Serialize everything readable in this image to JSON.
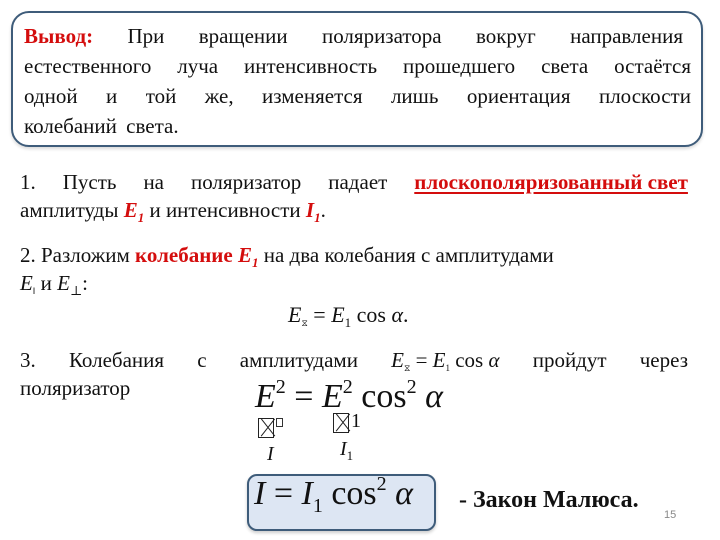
{
  "conclusion": {
    "label": "Вывод:",
    "line1_words": [
      "При",
      "вращении",
      "поляризатора",
      "вокруг",
      "направления"
    ],
    "line2_words": [
      "естественного",
      "луча",
      "интенсивность",
      "прошедшего",
      "света",
      "остаётся"
    ],
    "line3_words": [
      "одной",
      "и",
      "той",
      "же,",
      "изменяется",
      "лишь",
      "ориентация",
      "плоскости"
    ],
    "line4": "колебаний света."
  },
  "point1": {
    "line1_words": [
      "1.",
      "Пусть",
      "на",
      "поляризатор",
      "падает"
    ],
    "highlight": "плоскополяризованный свет",
    "line2_prefix": "амплитуды ",
    "var_E": "E",
    "var_E_sub": "1",
    "line2_mid": " и интенсивности ",
    "var_I": "I",
    "var_I_sub": "1",
    "line2_suffix": "."
  },
  "point2": {
    "prefix": "2. Разложим ",
    "highlight": "колебание",
    "var_E": "E",
    "var_E_sub": "1",
    "suffix": " на два колебания с амплитудами",
    "line2_E_par": "E",
    "line2_par_sub": "‖",
    "line2_mid": " и ",
    "line2_E_perp": "E",
    "line2_perp_sub": "⊥",
    "line2_suffix": ":"
  },
  "formula1": {
    "lhs": "E",
    "lhs_sub": "⧖",
    "eq": " = ",
    "rhs": "E",
    "rhs_sub": "1",
    "cos": " cos ",
    "alpha": "α",
    "end": "."
  },
  "point3": {
    "words_before": [
      "3.",
      "Колебания",
      "с",
      "амплитудами"
    ],
    "formula": {
      "lhs": "E",
      "lhs_sub": "⧖",
      "eq": " = ",
      "rhs": "E",
      "rhs_sub": "1",
      "cos": " cos ",
      "alpha": "α"
    },
    "words_after": [
      "пройдут",
      "через"
    ],
    "line2": "поляризатор"
  },
  "formula2": {
    "lhs": "E",
    "lhs_sup": "2",
    "eq": " = ",
    "rhs": "E",
    "rhs_sup": "2",
    "cos": " cos",
    "cos_sup": "2",
    "alpha": " α",
    "sub_rhs": "1",
    "under_lhs": "I",
    "under_rhs": "I",
    "under_rhs_sub": "1"
  },
  "malus": {
    "lhs": "I",
    "eq": " = ",
    "rhs": "I",
    "rhs_sub": "1",
    "cos": " cos",
    "cos_sup": "2",
    "alpha": " α",
    "law_label": "- Закон Малюса."
  },
  "page_number": "15",
  "colors": {
    "accent_red": "#d40d0d",
    "box_border": "#3e5c7a",
    "formula_box_fill": "#dde6f3"
  }
}
